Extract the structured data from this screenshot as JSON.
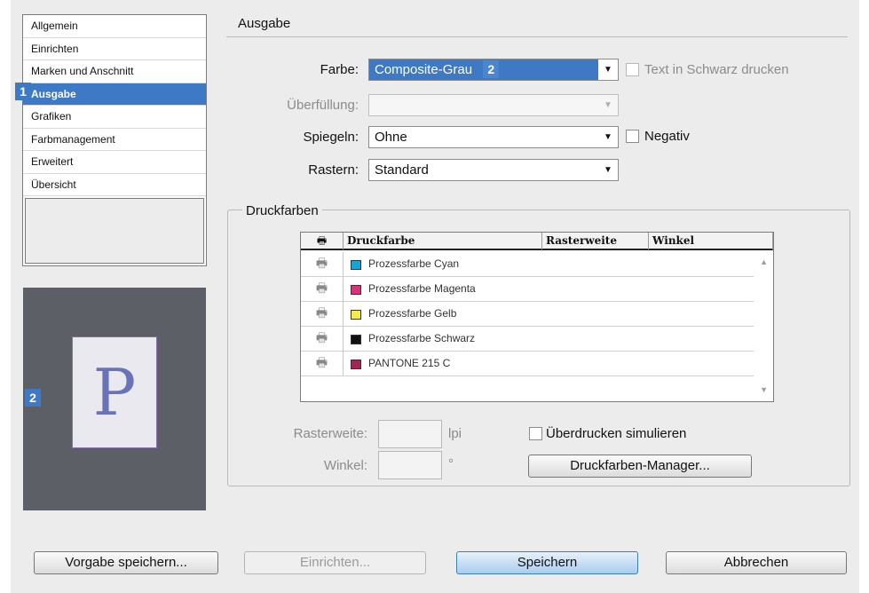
{
  "categories": {
    "items": [
      "Allgemein",
      "Einrichten",
      "Marken und Anschnitt",
      "Ausgabe",
      "Grafiken",
      "Farbmanagement",
      "Erweitert",
      "Übersicht"
    ],
    "selected_index": 3
  },
  "badges": {
    "one": "1",
    "two": "2"
  },
  "preview": {
    "letter": "P"
  },
  "section": {
    "title": "Ausgabe"
  },
  "fields": {
    "farbe": {
      "label": "Farbe:",
      "value": "Composite-Grau"
    },
    "text_schwarz": {
      "label": "Text in Schwarz drucken",
      "checked": false
    },
    "ueberfuellung": {
      "label": "Überfüllung:",
      "value": ""
    },
    "spiegeln": {
      "label": "Spiegeln:",
      "value": "Ohne"
    },
    "negativ": {
      "label": "Negativ",
      "checked": false
    },
    "rastern": {
      "label": "Rastern:",
      "value": "Standard"
    }
  },
  "druckfarben": {
    "legend": "Druckfarben",
    "columns": [
      "Druckfarbe",
      "Rasterweite",
      "Winkel"
    ],
    "rows": [
      {
        "name": "Prozessfarbe Cyan",
        "color": "#1aa3d6"
      },
      {
        "name": "Prozessfarbe Magenta",
        "color": "#d8337a"
      },
      {
        "name": "Prozessfarbe Gelb",
        "color": "#f4ea4a"
      },
      {
        "name": "Prozessfarbe Schwarz",
        "color": "#111111"
      },
      {
        "name": "PANTONE 215 C",
        "color": "#a02656"
      }
    ],
    "rasterweite_label": "Rasterweite:",
    "rasterweite_unit": "lpi",
    "winkel_label": "Winkel:",
    "winkel_unit": "°",
    "ueberdrucken": {
      "label": "Überdrucken simulieren",
      "checked": false
    },
    "manager_button": "Druckfarben-Manager..."
  },
  "footer": {
    "vorgabe": "Vorgabe speichern...",
    "einrichten": "Einrichten...",
    "speichern": "Speichern",
    "abbrechen": "Abbrechen"
  }
}
